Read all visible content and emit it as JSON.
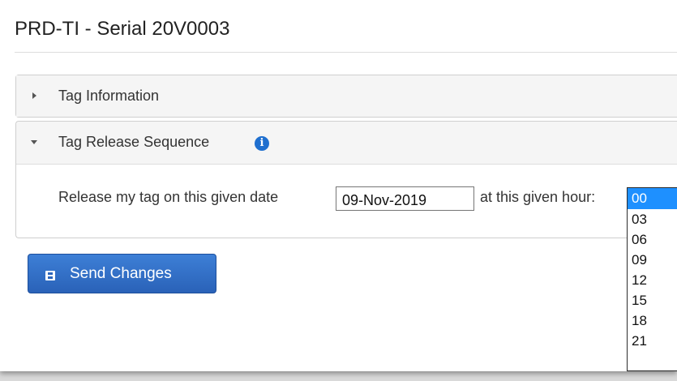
{
  "page": {
    "title": "PRD-TI - Serial 20V0003"
  },
  "panels": {
    "tag_information": {
      "label": "Tag Information"
    },
    "tag_release": {
      "label": "Tag Release Sequence",
      "date_label": "Release my tag on this given date",
      "date_value": "09-Nov-2019",
      "hour_label": "at this given hour:",
      "hour_options": [
        "00",
        "03",
        "06",
        "09",
        "12",
        "15",
        "18",
        "21"
      ],
      "selected_hour": "00"
    }
  },
  "actions": {
    "send_label": "Send Changes"
  },
  "icons": {
    "info": "info-icon",
    "send": "floppy-disk-icon",
    "collapsed": "caret-right-icon",
    "expanded": "caret-down-icon"
  },
  "colors": {
    "primary_button": "#2f6cc4",
    "info_icon": "#1f6fcf",
    "selected_option": "#1e90ff"
  }
}
